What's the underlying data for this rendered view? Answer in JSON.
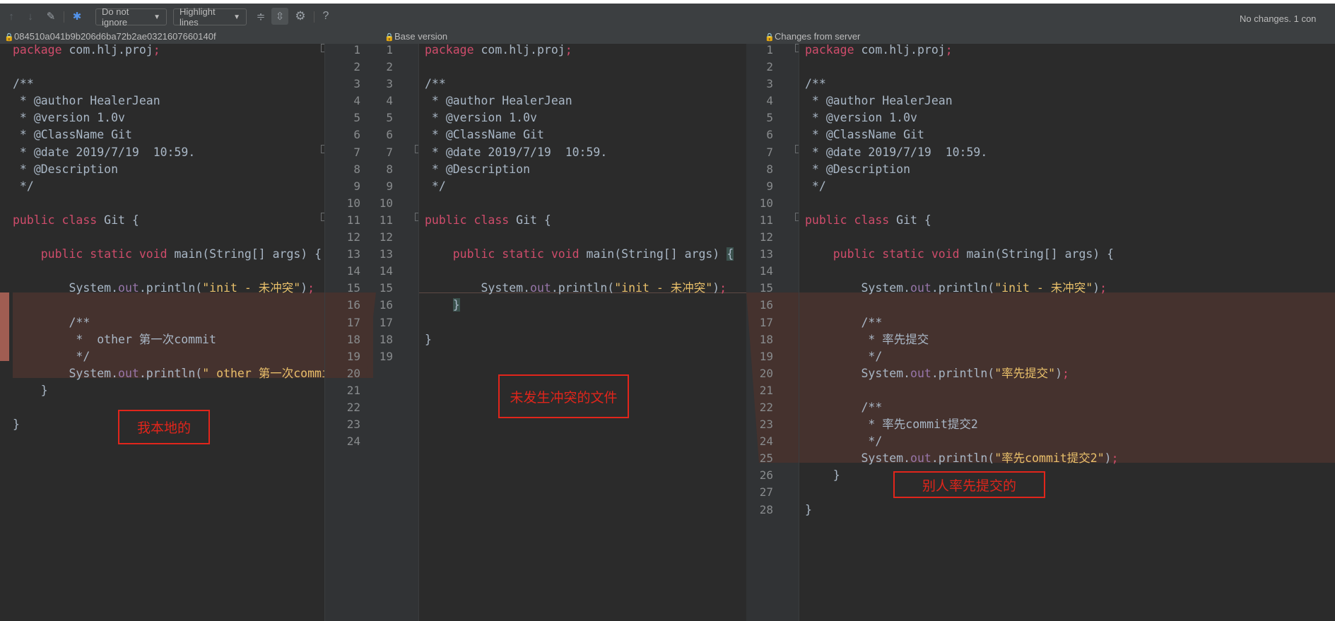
{
  "toolbar": {
    "ignore_label": "Do not ignore",
    "highlight_label": "Highlight lines",
    "help": "?",
    "status": "No changes. 1 con"
  },
  "panes": {
    "left_title": "084510a041b9b206d6ba72b2ae0321607660140f",
    "middle_title": "Base version",
    "right_title": "Changes from server"
  },
  "annotations": {
    "left": "我本地的",
    "middle": "未发生冲突的文件",
    "right": "别人率先提交的"
  },
  "left_lines": [
    "1",
    "2",
    "3",
    "4",
    "5",
    "6",
    "7",
    "8",
    "9",
    "10",
    "11",
    "12",
    "13",
    "14",
    "15",
    "16",
    "17",
    "18",
    "19",
    "20",
    "21",
    "22",
    "23",
    "24"
  ],
  "mid_lines": [
    "1",
    "2",
    "3",
    "4",
    "5",
    "6",
    "7",
    "8",
    "9",
    "10",
    "11",
    "12",
    "13",
    "14",
    "15",
    "16",
    "17",
    "18",
    "19"
  ],
  "right_lines": [
    "1",
    "2",
    "3",
    "4",
    "5",
    "6",
    "7",
    "8",
    "9",
    "10",
    "11",
    "12",
    "13",
    "14",
    "15",
    "16",
    "17",
    "18",
    "19",
    "20",
    "21",
    "22",
    "23",
    "24",
    "25",
    "26",
    "27",
    "28"
  ],
  "colors": {
    "accent": "#cc7832",
    "conflict": "#45322e",
    "annotation": "#e1251b"
  }
}
